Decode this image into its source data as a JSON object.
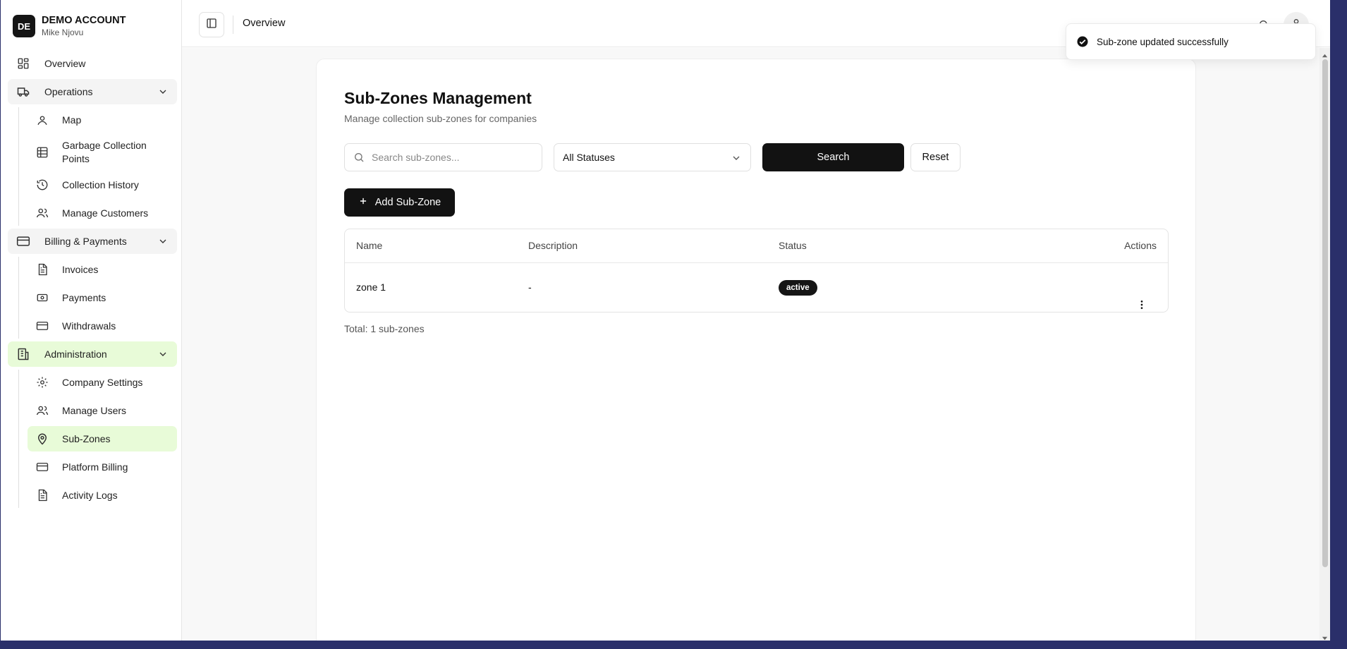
{
  "account": {
    "initials": "DE",
    "name": "DEMO ACCOUNT",
    "user": "Mike Njovu"
  },
  "sidebar": {
    "overview": "Overview",
    "operations": {
      "label": "Operations",
      "items": [
        "Map",
        "Garbage Collection Points",
        "Collection History",
        "Manage Customers"
      ]
    },
    "billing": {
      "label": "Billing & Payments",
      "items": [
        "Invoices",
        "Payments",
        "Withdrawals"
      ]
    },
    "administration": {
      "label": "Administration",
      "items": [
        "Company Settings",
        "Manage Users",
        "Sub-Zones",
        "Platform Billing",
        "Activity Logs"
      ]
    }
  },
  "header": {
    "title": "Overview"
  },
  "page": {
    "title": "Sub-Zones Management",
    "subtitle": "Manage collection sub-zones for companies",
    "search_placeholder": "Search sub-zones...",
    "status_filter": "All Statuses",
    "search_label": "Search",
    "reset_label": "Reset",
    "add_label": "Add Sub-Zone",
    "table": {
      "columns": [
        "Name",
        "Description",
        "Status",
        "Actions"
      ],
      "rows": [
        {
          "name": "zone 1",
          "description": "-",
          "status": "active"
        }
      ]
    },
    "total": "Total: 1 sub-zones"
  },
  "toast": {
    "message": "Sub-zone updated successfully"
  },
  "colors": {
    "accent_active": "#e8fbd8",
    "primary_button": "#121212"
  }
}
